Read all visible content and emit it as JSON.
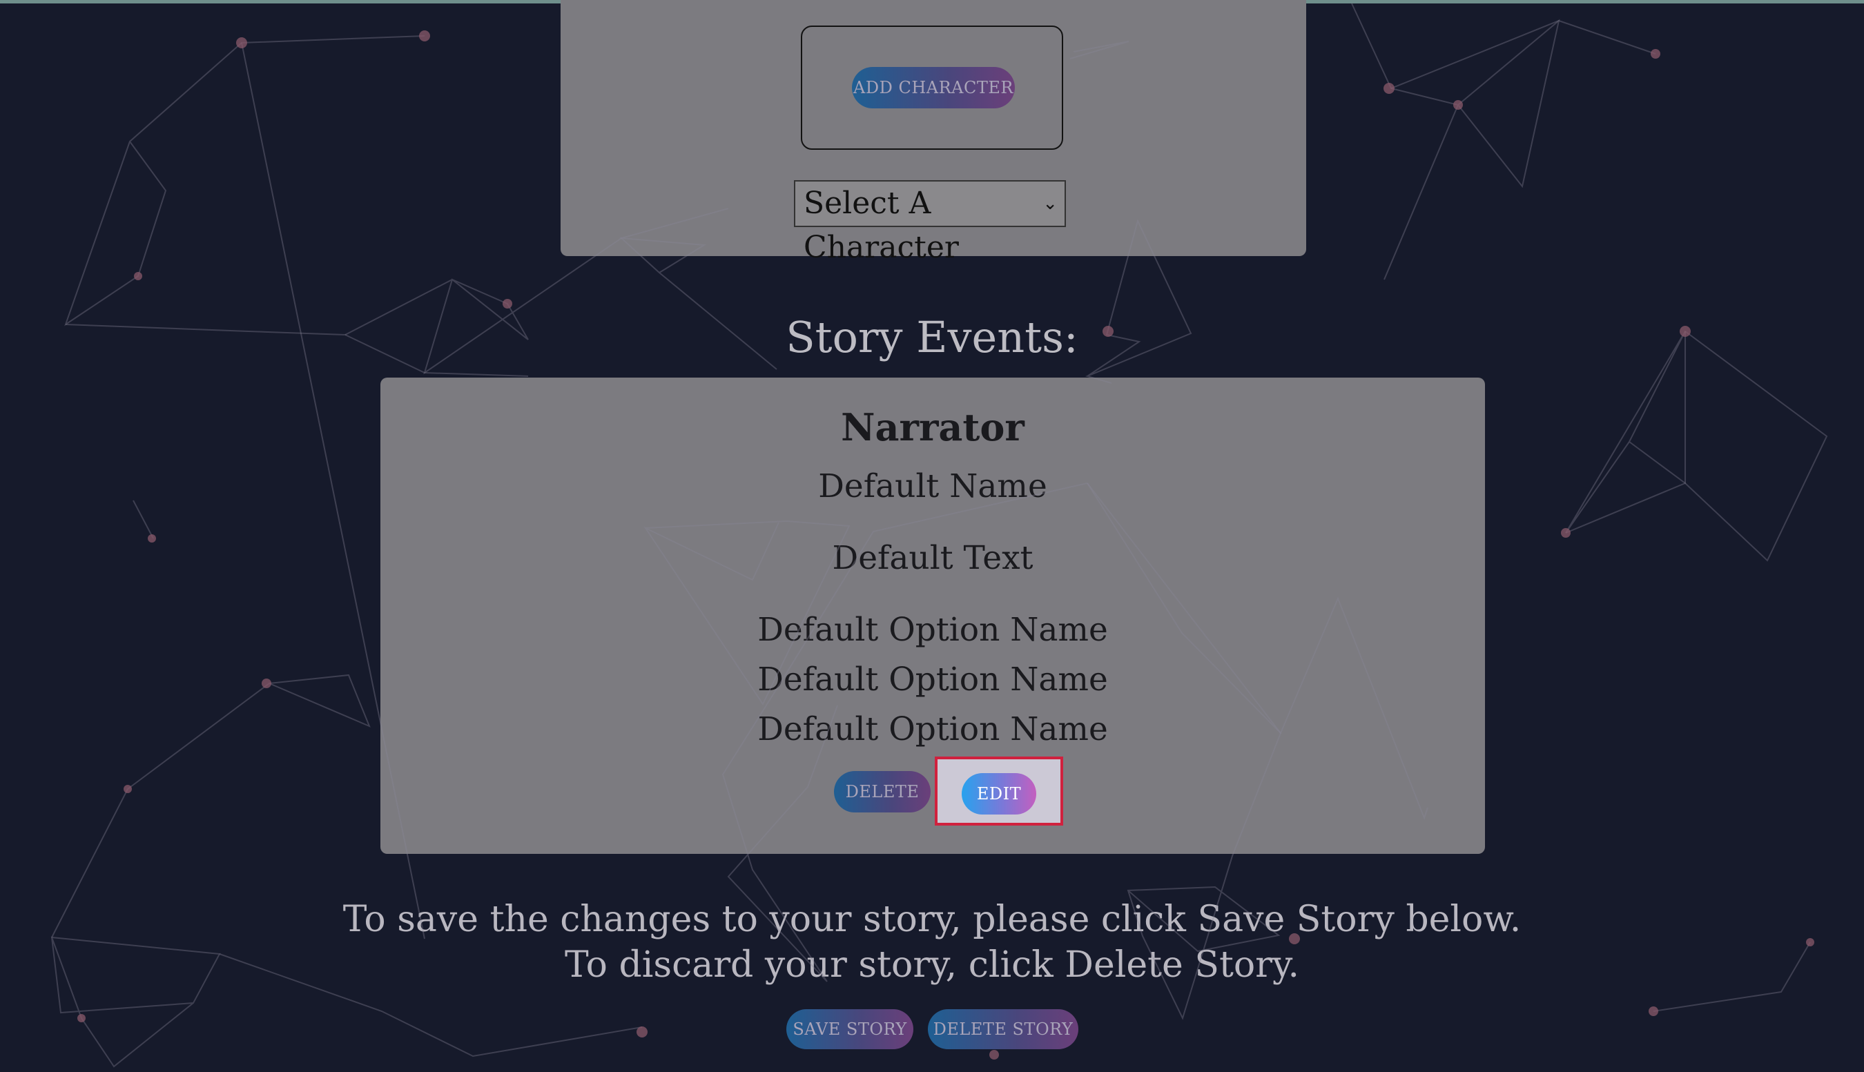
{
  "character_section": {
    "add_character_label": "ADD CHARACTER",
    "select_character_value": "Select A Character"
  },
  "events_section": {
    "title": "Story Events:",
    "event": {
      "speaker": "Narrator",
      "name": "Default Name",
      "text": "Default Text",
      "options": [
        "Default Option Name",
        "Default Option Name",
        "Default Option Name"
      ],
      "delete_label": "DELETE",
      "edit_label": "EDIT"
    }
  },
  "footer": {
    "line1": "To save the changes to your story, please click Save Story below.",
    "line2": "To discard your story, click Delete Story.",
    "save_label": "SAVE STORY",
    "delete_story_label": "DELETE STORY"
  },
  "colors": {
    "background": "#161a2b",
    "panel": "#7c7b80",
    "highlight": "#d0213e",
    "button_gradient_start": "#2a7bd0",
    "button_gradient_end": "#8e47a0"
  }
}
